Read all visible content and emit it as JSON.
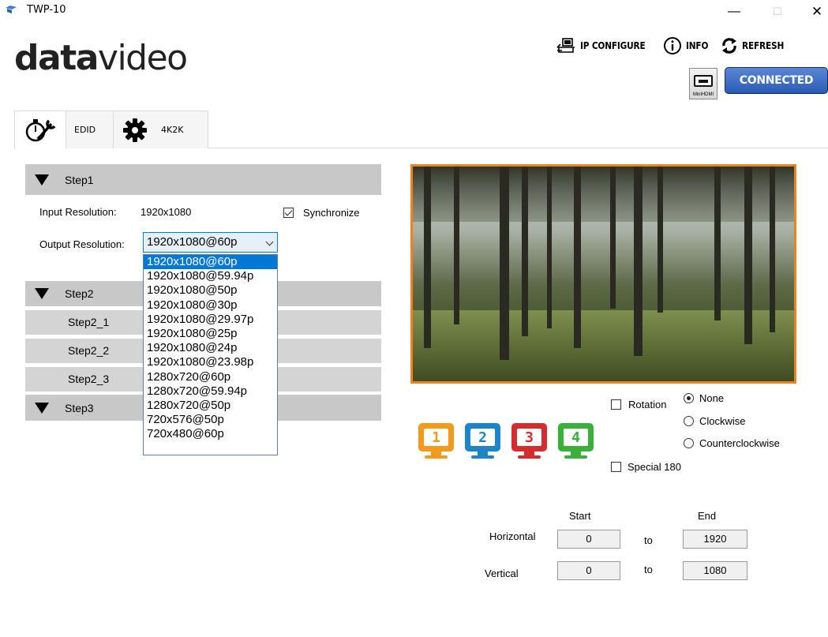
{
  "window": {
    "title": "TWP-10",
    "min": "—",
    "max": "☐",
    "close": "✕"
  },
  "logo": {
    "bold": "data",
    "light": "video"
  },
  "toolbar": {
    "ip_configure": "IP CONFIGURE",
    "info": "INFO",
    "refresh": "REFRESH"
  },
  "device": {
    "mini_label": "MiniHDMI",
    "status": "CONNECTED",
    "status_color": "#2a5bb5"
  },
  "tabs": {
    "edid": "EDID",
    "k4k2": "4K2K"
  },
  "steps": {
    "step1": "Step1",
    "step2": "Step2",
    "step2_1": "Step2_1",
    "step2_2": "Step2_2",
    "step2_3": "Step2_3",
    "step3": "Step3"
  },
  "input": {
    "label": "Input Resolution:",
    "value": "1920x1080"
  },
  "synchronize": {
    "label": "Synchronize",
    "checked": true
  },
  "output": {
    "label": "Output Resolution:",
    "selected": "1920x1080@60p",
    "options": [
      "1920x1080@60p",
      "1920x1080@59.94p",
      "1920x1080@50p",
      "1920x1080@30p",
      "1920x1080@29.97p",
      "1920x1080@25p",
      "1920x1080@24p",
      "1920x1080@23.98p",
      "1280x720@60p",
      "1280x720@59.94p",
      "1280x720@50p",
      "720x576@50p",
      "720x480@60p"
    ]
  },
  "monitors": [
    {
      "num": "1",
      "color": "#f39a1e"
    },
    {
      "num": "2",
      "color": "#1f84c6"
    },
    {
      "num": "3",
      "color": "#d42d2d"
    },
    {
      "num": "4",
      "color": "#3ab03a"
    }
  ],
  "rotation": {
    "label": "Rotation",
    "checked": false,
    "none": "None",
    "clockwise": "Clockwise",
    "counterclockwise": "Counterclockwise",
    "selected": "None"
  },
  "special180": {
    "label": "Special 180",
    "checked": false
  },
  "crop": {
    "start_header": "Start",
    "end_header": "End",
    "horizontal_label": "Horizontal",
    "vertical_label": "Vertical",
    "to": "to",
    "h_start": "0",
    "h_end": "1920",
    "v_start": "0",
    "v_end": "1080"
  }
}
